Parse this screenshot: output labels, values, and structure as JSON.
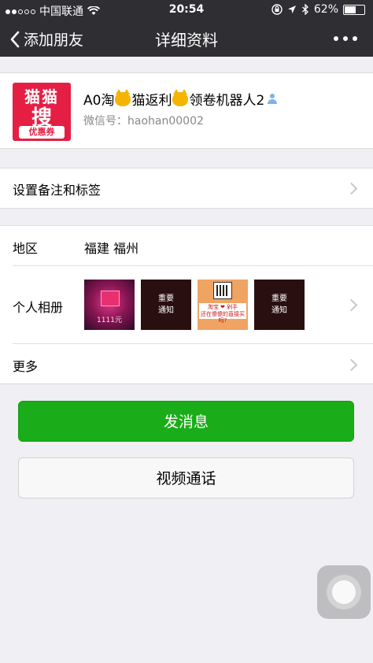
{
  "status_bar": {
    "carrier": "中国联通",
    "time": "20:54",
    "battery": "62%",
    "battery_level": 0.62
  },
  "nav": {
    "back_label": "添加朋友",
    "title": "详细资料"
  },
  "profile": {
    "avatar_text_top": "猫猫",
    "avatar_text_main": "搜",
    "avatar_coupon": "优惠券",
    "name_part1": "A0淘",
    "name_part2": "猫返利",
    "name_part3": "领卷机器人2",
    "wechat_id": "微信号：haohan00002"
  },
  "remark_row": {
    "label": "设置备注和标签"
  },
  "region_row": {
    "label": "地区",
    "value": "福建 福州"
  },
  "album_row": {
    "label": "个人相册",
    "photos": [
      {
        "caption": "1111元"
      },
      {
        "line1": "重要",
        "line2": "通知"
      },
      {
        "line1": "淘宝 ❤ 剁手",
        "line2": "还在傻傻的直接买吗?"
      },
      {
        "line1": "重要",
        "line2": "通知"
      }
    ]
  },
  "more_row": {
    "label": "更多"
  },
  "buttons": {
    "send_message": "发消息",
    "video_call": "视频通话"
  },
  "colors": {
    "nav_bg": "#2e2e33",
    "primary_green": "#1aad19",
    "page_bg": "#efeff4"
  }
}
